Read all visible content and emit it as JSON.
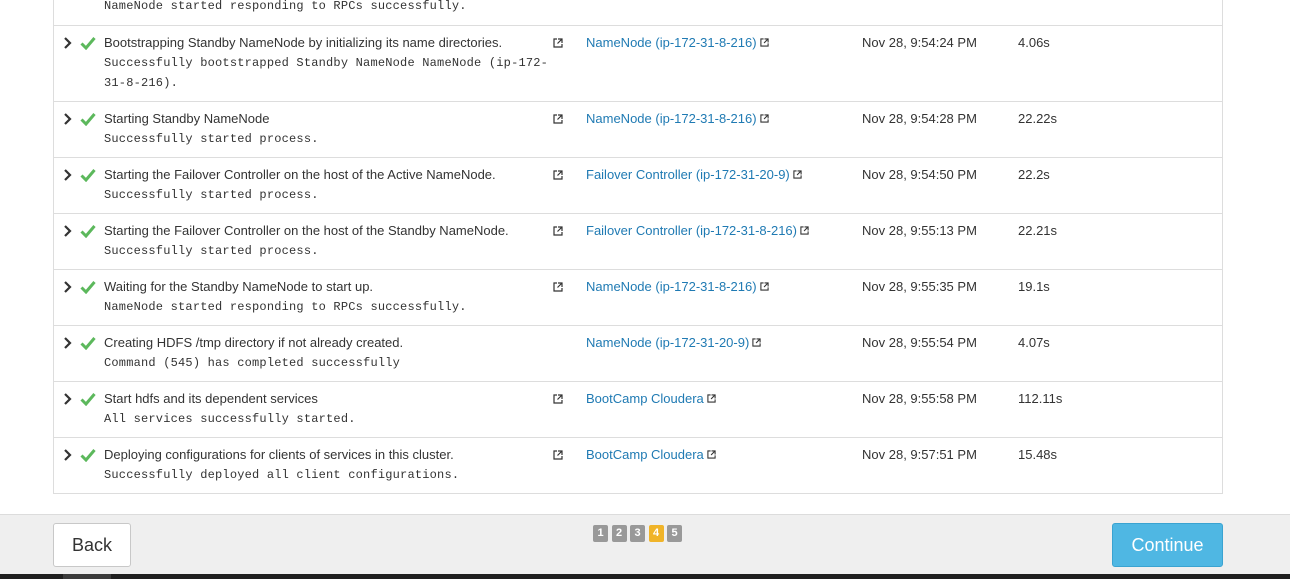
{
  "steps": [
    {
      "title": "",
      "message": "NameNode started responding to RPCs successfully."
    },
    {
      "title": "Bootstrapping Standby NameNode by initializing its name directories.",
      "message": "Successfully bootstrapped Standby NameNode NameNode (ip-172-\n31-8-216).",
      "context": "NameNode (ip-172-31-8-216)",
      "time": "Nov 28, 9:54:24 PM",
      "duration": "4.06s",
      "status": "success"
    },
    {
      "title": "Starting Standby NameNode",
      "message": "Successfully started process.",
      "context": "NameNode (ip-172-31-8-216)",
      "time": "Nov 28, 9:54:28 PM",
      "duration": "22.22s",
      "status": "success"
    },
    {
      "title": "Starting the Failover Controller on the host of the Active NameNode.",
      "message": "Successfully started process.",
      "context": "Failover Controller (ip-172-31-20-9)",
      "time": "Nov 28, 9:54:50 PM",
      "duration": "22.2s",
      "status": "success"
    },
    {
      "title": "Starting the Failover Controller on the host of the Standby NameNode.",
      "message": "Successfully started process.",
      "context": "Failover Controller (ip-172-31-8-216)",
      "time": "Nov 28, 9:55:13 PM",
      "duration": "22.21s",
      "status": "success"
    },
    {
      "title": "Waiting for the Standby NameNode to start up.",
      "message": "NameNode started responding to RPCs successfully.",
      "context": "NameNode (ip-172-31-8-216)",
      "time": "Nov 28, 9:55:35 PM",
      "duration": "19.1s",
      "status": "success"
    },
    {
      "title": "Creating HDFS /tmp directory if not already created.",
      "message": "Command (545) has completed successfully",
      "context": "NameNode (ip-172-31-20-9)",
      "time": "Nov 28, 9:55:54 PM",
      "duration": "4.07s",
      "status": "success"
    },
    {
      "title": "Start hdfs and its dependent services",
      "message": "All services successfully started.",
      "context": "BootCamp Cloudera",
      "time": "Nov 28, 9:55:58 PM",
      "duration": "112.11s",
      "status": "success"
    },
    {
      "title": "Deploying configurations for clients of services in this cluster.",
      "message": "Successfully deployed all client configurations.",
      "context": "BootCamp Cloudera",
      "time": "Nov 28, 9:57:51 PM",
      "duration": "15.48s",
      "status": "success"
    }
  ],
  "footer": {
    "back_label": "Back",
    "continue_label": "Continue",
    "pages": [
      "1",
      "2",
      "3",
      "4",
      "5"
    ],
    "current_page": "4"
  },
  "colors": {
    "link": "#1f7ab3",
    "success": "#5cb85c",
    "primary_button": "#4fb7e3",
    "active_page": "#f0b429",
    "inactive_page": "#999999"
  },
  "icons": {
    "expand": "chevron-right-icon",
    "status": "checkmark-icon",
    "open_details": "external-link-icon"
  }
}
